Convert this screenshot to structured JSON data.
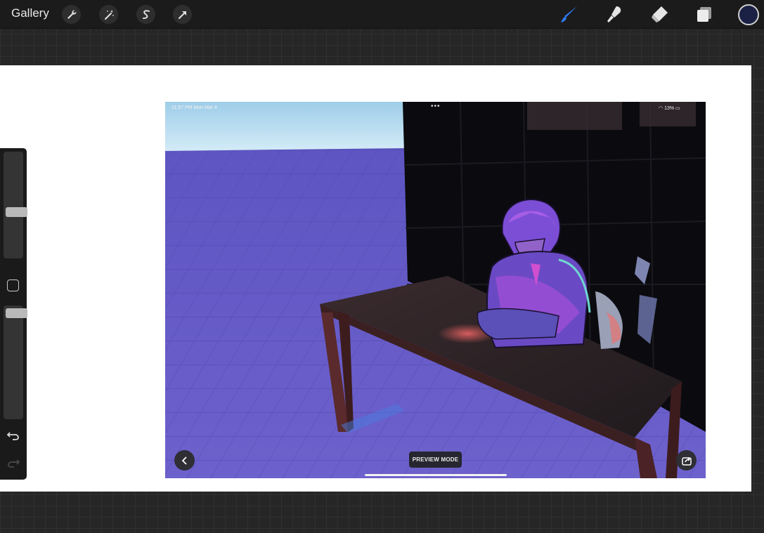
{
  "toolbar": {
    "gallery_label": "Gallery",
    "left_tools": [
      "wrench-icon",
      "magic-wand-icon",
      "selection-s-icon",
      "transform-arrow-icon"
    ],
    "right_tools": [
      "brush-icon",
      "smudge-icon",
      "eraser-icon",
      "layers-icon"
    ],
    "active_tool": "brush-icon",
    "active_color": "#1a2144",
    "accent": "#2f7cf6"
  },
  "sidebar": {
    "brush_size_fraction": 0.43,
    "opacity_fraction": 0.97,
    "icons": [
      "modify-square-icon",
      "undo-icon",
      "redo-icon"
    ]
  },
  "artwork": {
    "status_time": "11:57 PM  Mon Mar 4",
    "status_battery": "13%",
    "dots": "•••",
    "preview_label": "PREVIEW MODE",
    "colors": {
      "floor": "#6a5ec8",
      "sky": "#b6dcf2",
      "room": "#0b0b0f",
      "figure": "#9c4fd6"
    }
  }
}
